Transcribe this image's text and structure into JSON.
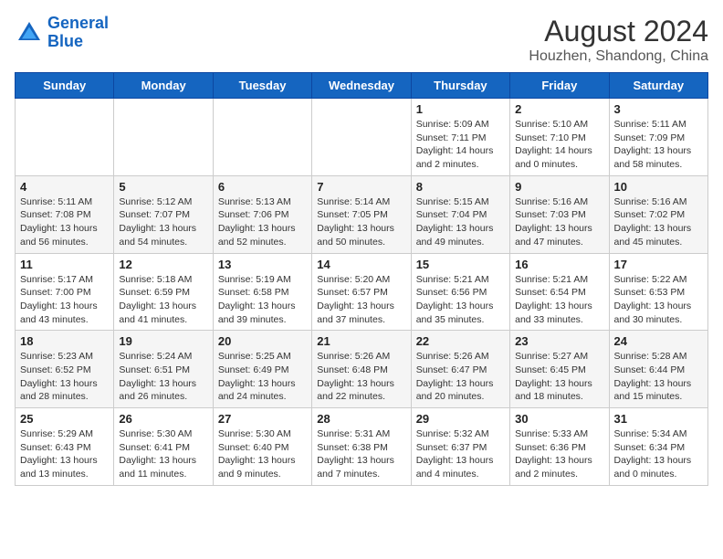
{
  "header": {
    "logo_line1": "General",
    "logo_line2": "Blue",
    "main_title": "August 2024",
    "sub_title": "Houzhen, Shandong, China"
  },
  "days_of_week": [
    "Sunday",
    "Monday",
    "Tuesday",
    "Wednesday",
    "Thursday",
    "Friday",
    "Saturday"
  ],
  "weeks": [
    [
      {
        "day": "",
        "info": ""
      },
      {
        "day": "",
        "info": ""
      },
      {
        "day": "",
        "info": ""
      },
      {
        "day": "",
        "info": ""
      },
      {
        "day": "1",
        "info": "Sunrise: 5:09 AM\nSunset: 7:11 PM\nDaylight: 14 hours\nand 2 minutes."
      },
      {
        "day": "2",
        "info": "Sunrise: 5:10 AM\nSunset: 7:10 PM\nDaylight: 14 hours\nand 0 minutes."
      },
      {
        "day": "3",
        "info": "Sunrise: 5:11 AM\nSunset: 7:09 PM\nDaylight: 13 hours\nand 58 minutes."
      }
    ],
    [
      {
        "day": "4",
        "info": "Sunrise: 5:11 AM\nSunset: 7:08 PM\nDaylight: 13 hours\nand 56 minutes."
      },
      {
        "day": "5",
        "info": "Sunrise: 5:12 AM\nSunset: 7:07 PM\nDaylight: 13 hours\nand 54 minutes."
      },
      {
        "day": "6",
        "info": "Sunrise: 5:13 AM\nSunset: 7:06 PM\nDaylight: 13 hours\nand 52 minutes."
      },
      {
        "day": "7",
        "info": "Sunrise: 5:14 AM\nSunset: 7:05 PM\nDaylight: 13 hours\nand 50 minutes."
      },
      {
        "day": "8",
        "info": "Sunrise: 5:15 AM\nSunset: 7:04 PM\nDaylight: 13 hours\nand 49 minutes."
      },
      {
        "day": "9",
        "info": "Sunrise: 5:16 AM\nSunset: 7:03 PM\nDaylight: 13 hours\nand 47 minutes."
      },
      {
        "day": "10",
        "info": "Sunrise: 5:16 AM\nSunset: 7:02 PM\nDaylight: 13 hours\nand 45 minutes."
      }
    ],
    [
      {
        "day": "11",
        "info": "Sunrise: 5:17 AM\nSunset: 7:00 PM\nDaylight: 13 hours\nand 43 minutes."
      },
      {
        "day": "12",
        "info": "Sunrise: 5:18 AM\nSunset: 6:59 PM\nDaylight: 13 hours\nand 41 minutes."
      },
      {
        "day": "13",
        "info": "Sunrise: 5:19 AM\nSunset: 6:58 PM\nDaylight: 13 hours\nand 39 minutes."
      },
      {
        "day": "14",
        "info": "Sunrise: 5:20 AM\nSunset: 6:57 PM\nDaylight: 13 hours\nand 37 minutes."
      },
      {
        "day": "15",
        "info": "Sunrise: 5:21 AM\nSunset: 6:56 PM\nDaylight: 13 hours\nand 35 minutes."
      },
      {
        "day": "16",
        "info": "Sunrise: 5:21 AM\nSunset: 6:54 PM\nDaylight: 13 hours\nand 33 minutes."
      },
      {
        "day": "17",
        "info": "Sunrise: 5:22 AM\nSunset: 6:53 PM\nDaylight: 13 hours\nand 30 minutes."
      }
    ],
    [
      {
        "day": "18",
        "info": "Sunrise: 5:23 AM\nSunset: 6:52 PM\nDaylight: 13 hours\nand 28 minutes."
      },
      {
        "day": "19",
        "info": "Sunrise: 5:24 AM\nSunset: 6:51 PM\nDaylight: 13 hours\nand 26 minutes."
      },
      {
        "day": "20",
        "info": "Sunrise: 5:25 AM\nSunset: 6:49 PM\nDaylight: 13 hours\nand 24 minutes."
      },
      {
        "day": "21",
        "info": "Sunrise: 5:26 AM\nSunset: 6:48 PM\nDaylight: 13 hours\nand 22 minutes."
      },
      {
        "day": "22",
        "info": "Sunrise: 5:26 AM\nSunset: 6:47 PM\nDaylight: 13 hours\nand 20 minutes."
      },
      {
        "day": "23",
        "info": "Sunrise: 5:27 AM\nSunset: 6:45 PM\nDaylight: 13 hours\nand 18 minutes."
      },
      {
        "day": "24",
        "info": "Sunrise: 5:28 AM\nSunset: 6:44 PM\nDaylight: 13 hours\nand 15 minutes."
      }
    ],
    [
      {
        "day": "25",
        "info": "Sunrise: 5:29 AM\nSunset: 6:43 PM\nDaylight: 13 hours\nand 13 minutes."
      },
      {
        "day": "26",
        "info": "Sunrise: 5:30 AM\nSunset: 6:41 PM\nDaylight: 13 hours\nand 11 minutes."
      },
      {
        "day": "27",
        "info": "Sunrise: 5:30 AM\nSunset: 6:40 PM\nDaylight: 13 hours\nand 9 minutes."
      },
      {
        "day": "28",
        "info": "Sunrise: 5:31 AM\nSunset: 6:38 PM\nDaylight: 13 hours\nand 7 minutes."
      },
      {
        "day": "29",
        "info": "Sunrise: 5:32 AM\nSunset: 6:37 PM\nDaylight: 13 hours\nand 4 minutes."
      },
      {
        "day": "30",
        "info": "Sunrise: 5:33 AM\nSunset: 6:36 PM\nDaylight: 13 hours\nand 2 minutes."
      },
      {
        "day": "31",
        "info": "Sunrise: 5:34 AM\nSunset: 6:34 PM\nDaylight: 13 hours\nand 0 minutes."
      }
    ]
  ]
}
